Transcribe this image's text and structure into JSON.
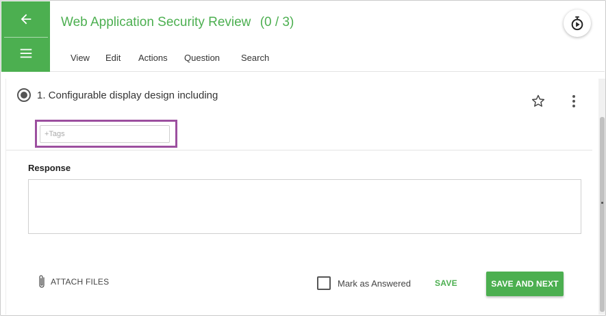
{
  "header": {
    "title": "Web Application Security Review",
    "count": "(0 / 3)",
    "nav": [
      "View",
      "Edit",
      "Actions",
      "Question",
      "Search"
    ]
  },
  "rail": {
    "back_icon": "arrow-left-icon",
    "menu_icon": "hamburger-icon"
  },
  "question": {
    "text": "1. Configurable display design including",
    "selected": true
  },
  "tags": {
    "placeholder": "+Tags"
  },
  "response": {
    "label": "Response",
    "value": ""
  },
  "footer": {
    "attach_label": "ATTACH FILES",
    "mark_label": "Mark as Answered",
    "save_label": "SAVE",
    "save_next_label": "SAVE AND NEXT"
  },
  "colors": {
    "accent": "#4caf50",
    "highlight": "#9c4f9f"
  }
}
